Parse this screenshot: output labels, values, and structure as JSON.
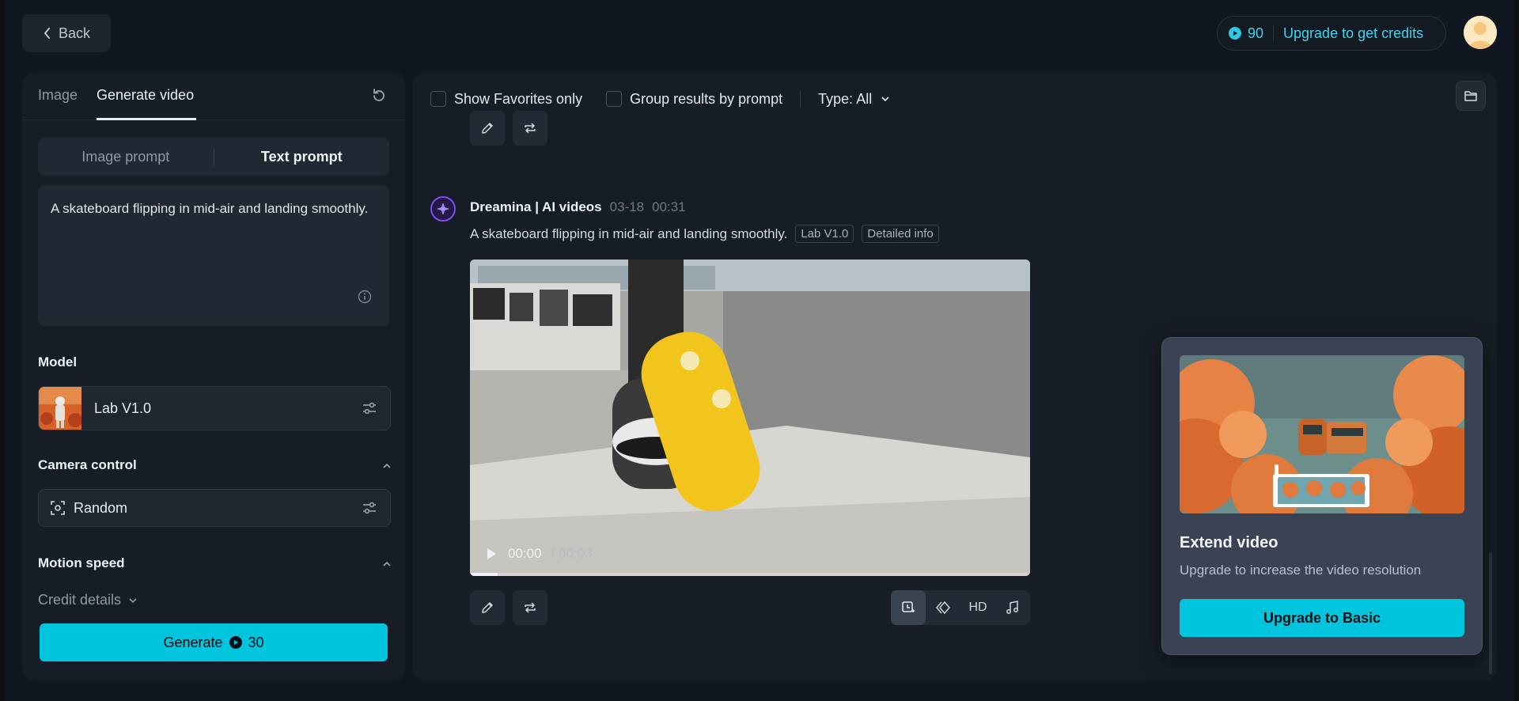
{
  "header": {
    "back_label": "Back",
    "credits": "90",
    "upgrade_label": "Upgrade to get credits"
  },
  "left_panel": {
    "tabs": [
      {
        "label": "Image"
      },
      {
        "label": "Generate video"
      }
    ],
    "prompt_modes": [
      {
        "label": "Image prompt"
      },
      {
        "label": "Text prompt"
      }
    ],
    "prompt_text": "A skateboard flipping in mid-air and landing smoothly.",
    "model_section_label": "Model",
    "model_name": "Lab V1.0",
    "camera_section_label": "Camera control",
    "camera_value": "Random",
    "motion_section_label": "Motion speed",
    "credit_details_label": "Credit details",
    "generate_label": "Generate",
    "generate_cost": "30"
  },
  "filters": {
    "favorites_label": "Show Favorites only",
    "group_label": "Group results by prompt",
    "type_label": "Type: All"
  },
  "generation": {
    "author": "Dreamina | AI videos",
    "date": "03-18",
    "time": "00:31",
    "prompt": "A skateboard flipping in mid-air and landing smoothly.",
    "model_tag": "Lab V1.0",
    "info_tag": "Detailed info",
    "video_current": "00:00",
    "video_duration": "/ 00:03",
    "video_progress": 0.05,
    "hd_label": "HD"
  },
  "popup": {
    "title": "Extend video",
    "description": "Upgrade to increase the video resolution",
    "button_label": "Upgrade to Basic"
  },
  "colors": {
    "accent": "#00c5dc",
    "credit_text": "#3ed4ef",
    "background": "#111720",
    "panel": "#171d26"
  },
  "icons": {
    "back": "chevron-left-icon",
    "reset": "reset-icon",
    "info": "info-icon",
    "settings": "sliders-icon",
    "camera": "focus-icon",
    "folder": "folder-icon",
    "edit": "pencil-icon",
    "regenerate": "repeat-icon",
    "extend": "extend-video-icon",
    "frame_interp": "diamond-icon",
    "music": "music-note-icon"
  }
}
